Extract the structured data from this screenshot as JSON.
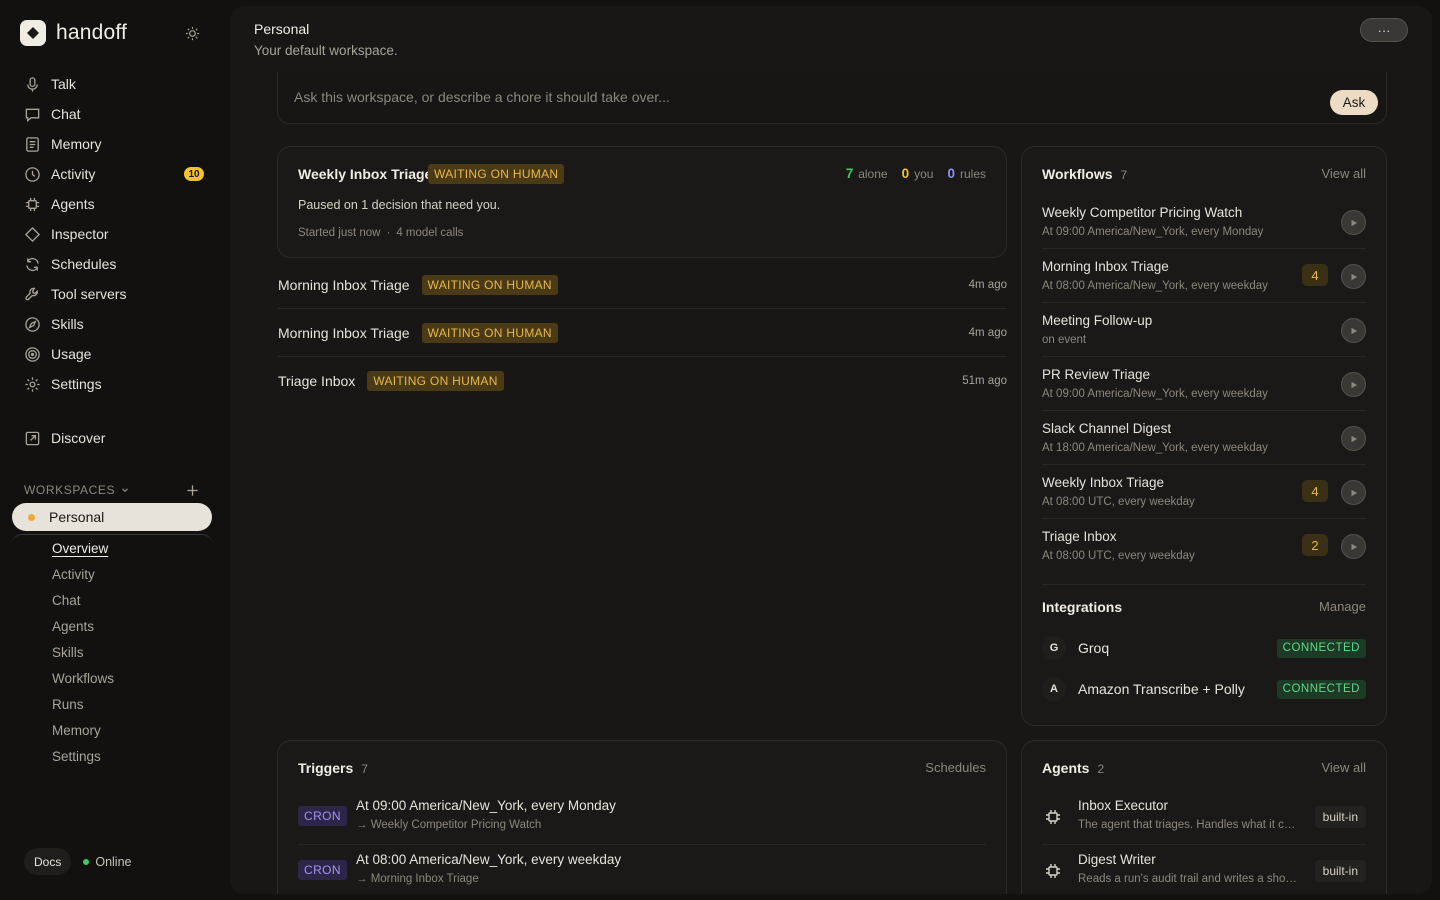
{
  "app": {
    "name": "handoff"
  },
  "sidebar": {
    "nav": [
      {
        "label": "Talk",
        "icon": "mic-icon"
      },
      {
        "label": "Chat",
        "icon": "chat-icon"
      },
      {
        "label": "Memory",
        "icon": "memory-icon"
      },
      {
        "label": "Activity",
        "icon": "clock-icon",
        "badge": "10"
      },
      {
        "label": "Agents",
        "icon": "chip-icon"
      },
      {
        "label": "Inspector",
        "icon": "diamond-icon"
      },
      {
        "label": "Schedules",
        "icon": "refresh-icon"
      },
      {
        "label": "Tool servers",
        "icon": "wrench-icon"
      },
      {
        "label": "Skills",
        "icon": "compass-icon"
      },
      {
        "label": "Usage",
        "icon": "target-icon"
      },
      {
        "label": "Settings",
        "icon": "gear-icon"
      }
    ],
    "discover": {
      "label": "Discover",
      "icon": "external-link-icon"
    },
    "workspaces": {
      "title": "WORKSPACES",
      "active": "Personal",
      "sub": [
        "Overview",
        "Activity",
        "Chat",
        "Agents",
        "Skills",
        "Workflows",
        "Runs",
        "Memory",
        "Settings"
      ]
    },
    "footer": {
      "docs": "Docs",
      "status": "Online"
    }
  },
  "header": {
    "title": "Personal",
    "subtitle": "Your default workspace.",
    "more": "···"
  },
  "ask": {
    "placeholder": "Ask this workspace, or describe a chore it should take over...",
    "button": "Ask"
  },
  "run_card": {
    "title": "Weekly Inbox Triage",
    "badge": "WAITING ON HUMAN",
    "stats": {
      "alone": "7",
      "alone_label": "alone",
      "you": "0",
      "you_label": "you",
      "rules": "0",
      "rules_label": "rules"
    },
    "desc": "Paused on 1 decision that need you.",
    "started": "Started just now",
    "sep": "·",
    "calls": "4 model calls"
  },
  "runs": [
    {
      "title": "Morning Inbox Triage",
      "badge": "WAITING ON HUMAN",
      "time": "4m ago"
    },
    {
      "title": "Morning Inbox Triage",
      "badge": "WAITING ON HUMAN",
      "time": "4m ago"
    },
    {
      "title": "Triage Inbox",
      "badge": "WAITING ON HUMAN",
      "time": "51m ago"
    }
  ],
  "workflows": {
    "title": "Workflows",
    "count": "7",
    "link": "View all",
    "items": [
      {
        "name": "Weekly Competitor Pricing Watch",
        "schedule": "At 09:00 America/New_York, every Monday",
        "count": ""
      },
      {
        "name": "Morning Inbox Triage",
        "schedule": "At 08:00 America/New_York, every weekday",
        "count": "4"
      },
      {
        "name": "Meeting Follow-up",
        "schedule": "on event",
        "count": ""
      },
      {
        "name": "PR Review Triage",
        "schedule": "At 09:00 America/New_York, every weekday",
        "count": ""
      },
      {
        "name": "Slack Channel Digest",
        "schedule": "At 18:00 America/New_York, every weekday",
        "count": ""
      },
      {
        "name": "Weekly Inbox Triage",
        "schedule": "At 08:00 UTC, every weekday",
        "count": "4"
      },
      {
        "name": "Triage Inbox",
        "schedule": "At 08:00 UTC, every weekday",
        "count": "2"
      }
    ]
  },
  "integrations": {
    "title": "Integrations",
    "link": "Manage",
    "items": [
      {
        "initial": "G",
        "name": "Groq",
        "status": "CONNECTED"
      },
      {
        "initial": "A",
        "name": "Amazon Transcribe + Polly",
        "status": "CONNECTED"
      }
    ]
  },
  "triggers": {
    "title": "Triggers",
    "count": "7",
    "link": "Schedules",
    "items": [
      {
        "type": "CRON",
        "when": "At 09:00 America/New_York, every Monday",
        "target": "→ Weekly Competitor Pricing Watch"
      },
      {
        "type": "CRON",
        "when": "At 08:00 America/New_York, every weekday",
        "target": "→ Morning Inbox Triage"
      }
    ]
  },
  "agents": {
    "title": "Agents",
    "count": "2",
    "link": "View all",
    "items": [
      {
        "name": "Inbox Executor",
        "desc": "The agent that triages. Handles what it can...",
        "tag": "built-in"
      },
      {
        "name": "Digest Writer",
        "desc": "Reads a run's audit trail and writes a short summary...",
        "tag": "built-in"
      }
    ]
  },
  "colors": {
    "accent_wait": "#e8b84a",
    "connected": "#5fd888",
    "online": "#3fc96a",
    "badge": "#f2c230",
    "cron": "#a792f0"
  }
}
